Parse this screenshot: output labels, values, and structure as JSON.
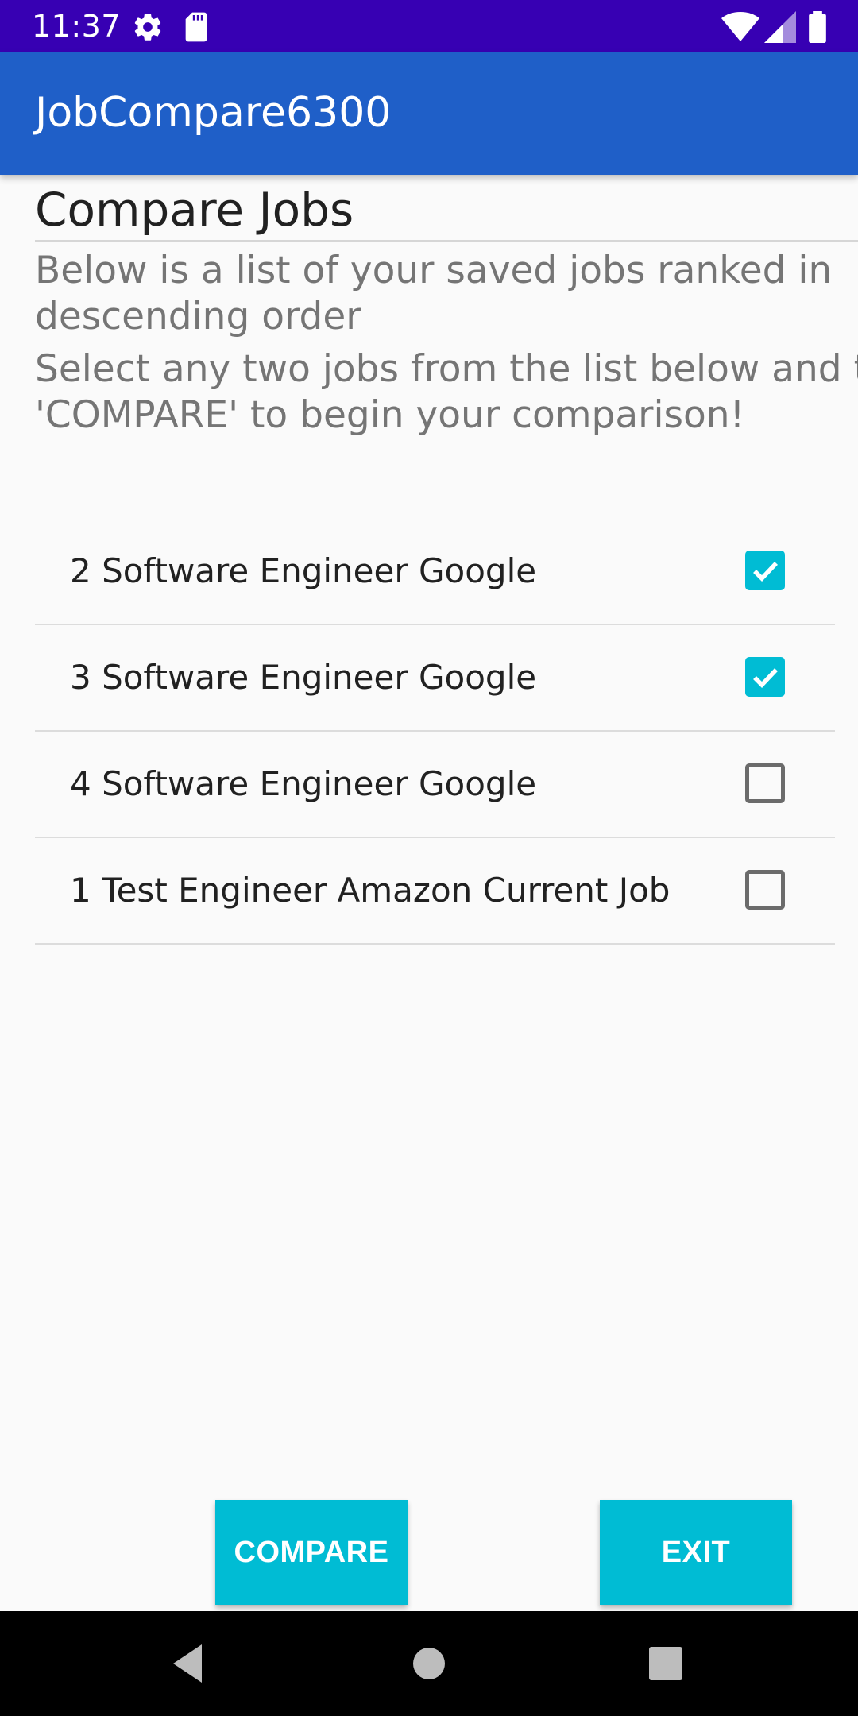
{
  "status_bar": {
    "time": "11:37",
    "left_icons": [
      "gear-icon",
      "sd-card-icon"
    ],
    "right_icons": [
      "wifi-icon",
      "cell-signal-icon",
      "battery-icon"
    ],
    "background_color": "#3700B3"
  },
  "app_bar": {
    "title": "JobCompare6300",
    "background_color": "#1F5FC8"
  },
  "main": {
    "heading": "Compare Jobs",
    "description_1": "Below is a list of your saved jobs ranked in descending order",
    "description_1_lines": [
      "Below is a list of your saved jobs ranked in",
      "descending order"
    ],
    "description_2": "Select any two jobs from the list below and tap 'COMPARE' to begin your comparison!",
    "description_2_lines": [
      "Select any two jobs from the list below and tap",
      "'COMPARE' to begin your comparison!"
    ],
    "jobs": [
      {
        "label": "2 Software Engineer Google",
        "checked": true
      },
      {
        "label": "3 Software Engineer Google",
        "checked": true
      },
      {
        "label": "4 Software Engineer Google",
        "checked": false
      },
      {
        "label": "1 Test Engineer Amazon Current Job",
        "checked": false
      }
    ],
    "accent_color": "#00BCD4"
  },
  "buttons": {
    "compare_label": "COMPARE",
    "exit_label": "EXIT"
  },
  "nav_bar": {
    "icons": [
      "back-triangle-icon",
      "home-circle-icon",
      "recents-square-icon"
    ]
  }
}
